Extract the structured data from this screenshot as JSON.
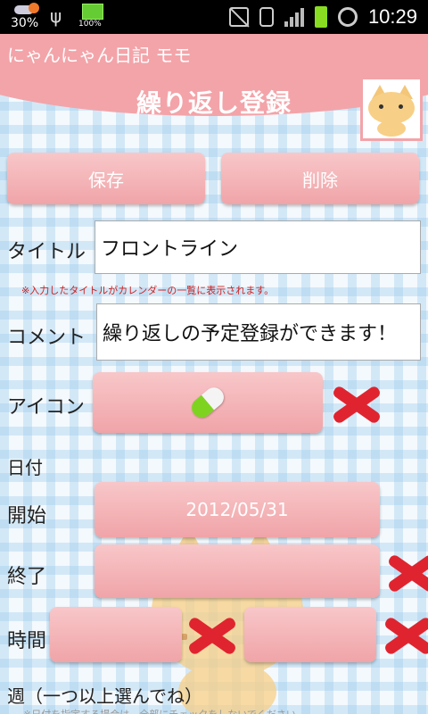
{
  "status_bar": {
    "temperature": "30%",
    "battery_percent": "100%",
    "time": "10:29"
  },
  "app_title": "にゃんにゃん日記 モモ",
  "screen_title": "繰り返し登録",
  "buttons": {
    "save": "保存",
    "delete": "削除"
  },
  "form": {
    "title_label": "タイトル",
    "title_value": "フロントライン",
    "title_note": "※入力したタイトルがカレンダーの一覧に表示されます。",
    "comment_label": "コメント",
    "comment_value": "繰り返しの予定登録ができます！",
    "icon_label": "アイコン",
    "icon_name": "pill-icon",
    "date_label": "日付",
    "start_label": "開始",
    "start_value": "2012/05/31",
    "end_label": "終了",
    "time_label": "時間",
    "week_label": "週（一つ以上選んでね）",
    "week_note": "※日付を指定する場合は、全部にチェックをしないでください"
  },
  "colors": {
    "accent_pink": "#f3a4a9",
    "delete_red": "#e0242f",
    "pill_green": "#7ed321"
  }
}
